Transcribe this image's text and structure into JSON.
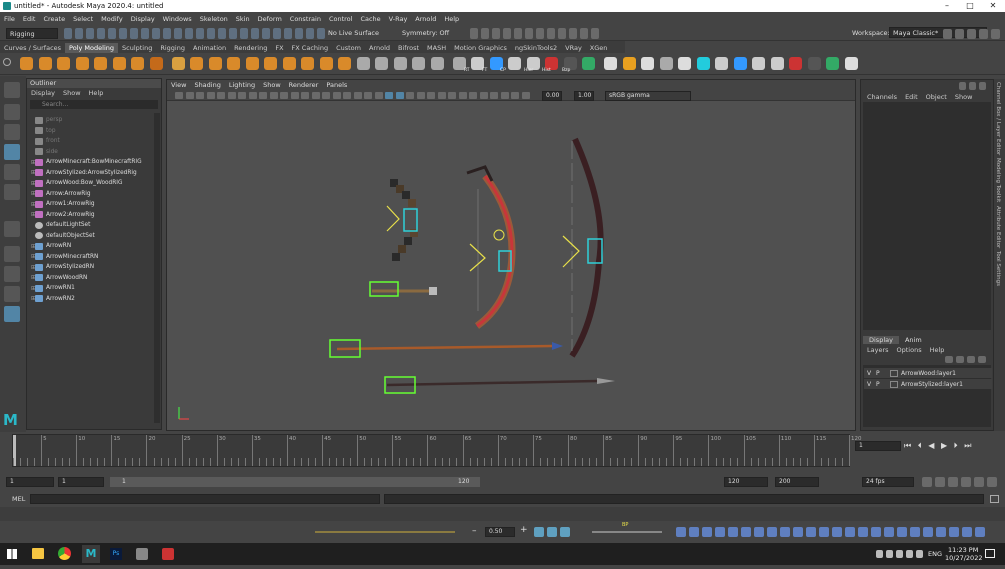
{
  "window": {
    "title": "untitled* - Autodesk Maya 2020.4: untitled",
    "min": "–",
    "max": "□",
    "close": "✕"
  },
  "menus": [
    "File",
    "Edit",
    "Create",
    "Select",
    "Modify",
    "Display",
    "Windows",
    "Skeleton",
    "Skin",
    "Deform",
    "Constrain",
    "Control",
    "Cache",
    "V-Ray",
    "Arnold",
    "Help"
  ],
  "workspace": {
    "label": "Workspace:",
    "value": "Maya Classic*"
  },
  "status": {
    "mode": "Rigging",
    "live_surface": "No Live Surface",
    "symmetry": "Symmetry: Off"
  },
  "shelf_tabs": [
    "Curves / Surfaces",
    "Poly Modeling",
    "Sculpting",
    "Rigging",
    "Animation",
    "Rendering",
    "FX",
    "FX Caching",
    "Custom",
    "Arnold",
    "Bifrost",
    "MASH",
    "Motion Graphics",
    "ngSkinTools2",
    "VRay",
    "XGen"
  ],
  "shelf_active": "Poly Modeling",
  "shelf_badges": [
    "RT",
    "FT",
    "CP",
    "Hier",
    "Hist",
    "Bzp"
  ],
  "outliner": {
    "title": "Outliner",
    "menu": [
      "Display",
      "Show",
      "Help"
    ],
    "search_placeholder": "Search...",
    "items": [
      {
        "label": "persp",
        "dim": true,
        "exp": false
      },
      {
        "label": "top",
        "dim": true,
        "exp": false
      },
      {
        "label": "front",
        "dim": true,
        "exp": false
      },
      {
        "label": "side",
        "dim": true,
        "exp": false
      },
      {
        "label": "ArrowMinecraft:BowMinecraftRIG",
        "dim": false,
        "exp": true
      },
      {
        "label": "ArrowStylized:ArrowStylizedRig",
        "dim": false,
        "exp": true
      },
      {
        "label": "ArrowWood:Bow_WoodRIG",
        "dim": false,
        "exp": true
      },
      {
        "label": "Arrow:ArrowRig",
        "dim": false,
        "exp": true
      },
      {
        "label": "Arrow1:ArrowRig",
        "dim": false,
        "exp": true
      },
      {
        "label": "Arrow2:ArrowRig",
        "dim": false,
        "exp": true
      },
      {
        "label": "defaultLightSet",
        "dim": false,
        "exp": false
      },
      {
        "label": "defaultObjectSet",
        "dim": false,
        "exp": false
      },
      {
        "label": "ArrowRN",
        "dim": false,
        "exp": true
      },
      {
        "label": "ArrowMinecraftRN",
        "dim": false,
        "exp": true
      },
      {
        "label": "ArrowStylizedRN",
        "dim": false,
        "exp": true
      },
      {
        "label": "ArrowWoodRN",
        "dim": false,
        "exp": true
      },
      {
        "label": "ArrowRN1",
        "dim": false,
        "exp": true
      },
      {
        "label": "ArrowRN2",
        "dim": false,
        "exp": true
      }
    ]
  },
  "viewport": {
    "menu": [
      "View",
      "Shading",
      "Lighting",
      "Show",
      "Renderer",
      "Panels"
    ],
    "val1": "0.00",
    "val2": "1.00",
    "colorspace": "sRGB gamma"
  },
  "channel_box": {
    "menu": [
      "Channels",
      "Edit",
      "Object",
      "Show"
    ]
  },
  "layer_editor": {
    "tabs": [
      "Display",
      "Anim"
    ],
    "menu": [
      "Layers",
      "Options",
      "Help"
    ],
    "layers": [
      {
        "v": "V",
        "p": "P",
        "name": "ArrowWood:layer1"
      },
      {
        "v": "V",
        "p": "P",
        "name": "ArrowStylized:layer1"
      }
    ]
  },
  "side_tabs": [
    "Channel Box / Layer Editor",
    "Modeling Toolkit",
    "Attribute Editor",
    "Tool Settings"
  ],
  "timeline": {
    "ticks": [
      "5",
      "10",
      "15",
      "20",
      "25",
      "30",
      "35",
      "40",
      "45",
      "50",
      "55",
      "60",
      "65",
      "70",
      "75",
      "80",
      "85",
      "90",
      "95",
      "100",
      "105",
      "110",
      "115",
      "120"
    ],
    "current": "1"
  },
  "range": {
    "start": "1",
    "start2": "1",
    "slider_start": "1",
    "slider_end": "120",
    "end": "120",
    "end2": "200",
    "fps": "24 fps"
  },
  "command": {
    "label": "MEL"
  },
  "anim": {
    "value": "0.50",
    "bp": "BP"
  },
  "taskbar": {
    "time": "11:23 PM",
    "date": "10/27/2022",
    "lang": "ENG"
  },
  "colors": {
    "accent": "#5285a6",
    "selection_green": "#66ff33",
    "control_cyan": "#2fd0d8",
    "ctrl_yellow": "#e8e04a"
  }
}
